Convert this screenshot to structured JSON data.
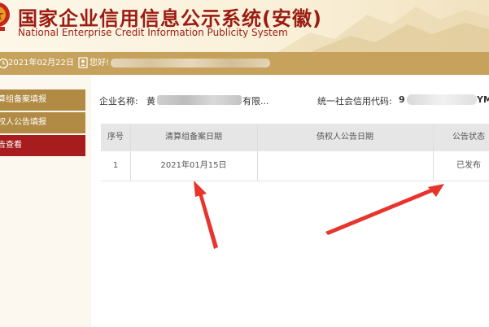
{
  "header": {
    "title_cn": "国家企业信用信息公示系统(安徽)",
    "title_en": "National Enterprise Credit Information Publicity System"
  },
  "infobar": {
    "date": "2021年02月22日",
    "greeting": "您好!"
  },
  "sidebar": {
    "items": [
      {
        "label": "算组备案填报"
      },
      {
        "label": "权人公告填报"
      },
      {
        "label": "告查看"
      }
    ]
  },
  "company": {
    "name_label": "企业名称:",
    "name_prefix": "黄",
    "name_suffix": "有限...",
    "credit_label": "统一社会信用代码:",
    "credit_prefix": "9",
    "credit_suffix": "YM"
  },
  "table": {
    "headers": [
      "序号",
      "清算组备案日期",
      "债权人公告日期",
      "公告状态"
    ],
    "rows": [
      {
        "seq": "1",
        "filing_date": "2021年01月15日",
        "creditor_date": "",
        "status": "已发布"
      }
    ]
  },
  "colors": {
    "brand_red": "#9b1c12",
    "gold": "#c6a25d",
    "sidebar_active": "#a71c1d",
    "annotation_arrow": "#e8342c"
  }
}
